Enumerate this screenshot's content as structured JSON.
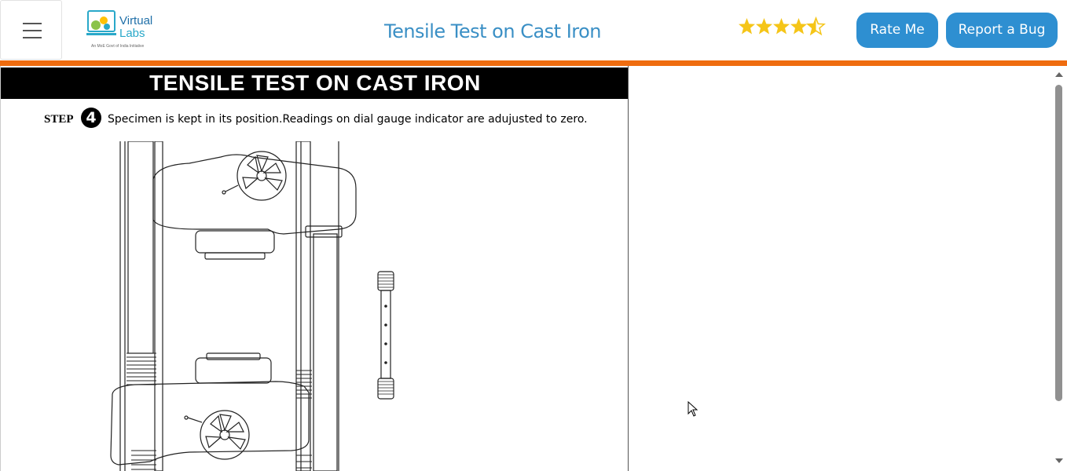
{
  "header": {
    "logo": {
      "line1": "Virtual",
      "line2": "Labs",
      "tagline": "An MoE Govt of India Initiative"
    },
    "title": "Tensile Test on Cast Iron",
    "rating": {
      "value": 4.5,
      "max": 5
    },
    "rate_button": "Rate Me",
    "bug_button": "Report a Bug"
  },
  "experiment": {
    "banner": "TENSILE TEST ON CAST IRON",
    "step_label": "STEP",
    "step_number": "4",
    "step_text": "Specimen is kept in its position.Readings on dial gauge indicator are adujusted to zero."
  },
  "colors": {
    "accent_orange": "#ef6c0f",
    "button_blue": "#2e8fd1",
    "title_blue": "#3a8fc5",
    "star_gold": "#f5c518"
  },
  "icons": {
    "menu": "hamburger-menu-icon",
    "star": "star-icon",
    "cursor": "mouse-pointer-icon"
  }
}
